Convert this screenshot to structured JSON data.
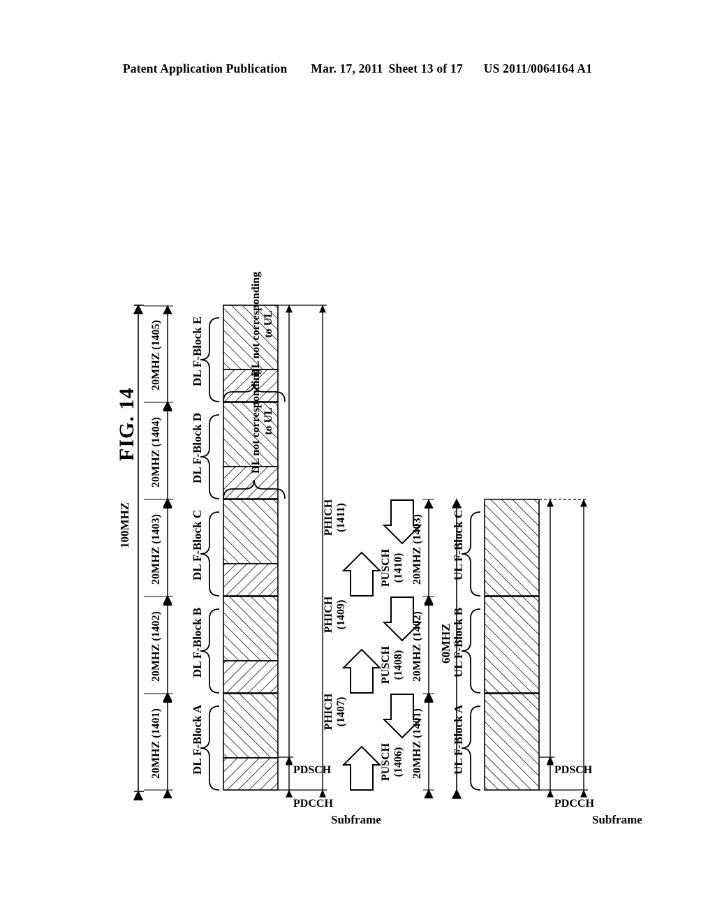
{
  "header": {
    "publication": "Patent Application Publication",
    "date": "Mar. 17, 2011",
    "sheet": "Sheet 13 of 17",
    "patent_number": "US 2011/0064164 A1"
  },
  "figure": {
    "title": "FIG. 14",
    "downlink": {
      "total_bandwidth": "100MHZ",
      "subframe_label": "Subframe",
      "control_region_label": "PDCCH",
      "data_region_label": "PDSCH",
      "blocks": [
        {
          "name": "DL F-Block A",
          "bandwidth": "20MHZ (1401)"
        },
        {
          "name": "DL F-Block B",
          "bandwidth": "20MHZ (1402)"
        },
        {
          "name": "DL F-Block C",
          "bandwidth": "20MHZ (1403)"
        },
        {
          "name": "DL F-Block D",
          "bandwidth": "20MHZ (1404)"
        },
        {
          "name": "DL F-Block E",
          "bandwidth": "20MHZ (1405)"
        }
      ],
      "notes": [
        {
          "line1": "DL not corresponding",
          "line2": "to UL"
        },
        {
          "line1": "DL not corresponding",
          "line2": "to UL"
        }
      ]
    },
    "uplink": {
      "total_bandwidth": "60MHZ",
      "subframe_label": "Subframe",
      "control_region_label": "PDCCH",
      "data_region_label": "PDSCH",
      "blocks": [
        {
          "name": "UL F-Block A",
          "bandwidth": "20MHZ (1401)"
        },
        {
          "name": "UL F-Block B",
          "bandwidth": "20MHZ (1402)"
        },
        {
          "name": "UL F-Block C",
          "bandwidth": "20MHZ (1403)"
        }
      ]
    },
    "links": [
      {
        "up_channel": "PUSCH",
        "up_ref": "(1406)",
        "down_channel": "PHICH",
        "down_ref": "(1407)"
      },
      {
        "up_channel": "PUSCH",
        "up_ref": "(1408)",
        "down_channel": "PHICH",
        "down_ref": "(1409)"
      },
      {
        "up_channel": "PUSCH",
        "up_ref": "(1410)",
        "down_channel": "PHICH",
        "down_ref": "(1411)"
      }
    ]
  }
}
